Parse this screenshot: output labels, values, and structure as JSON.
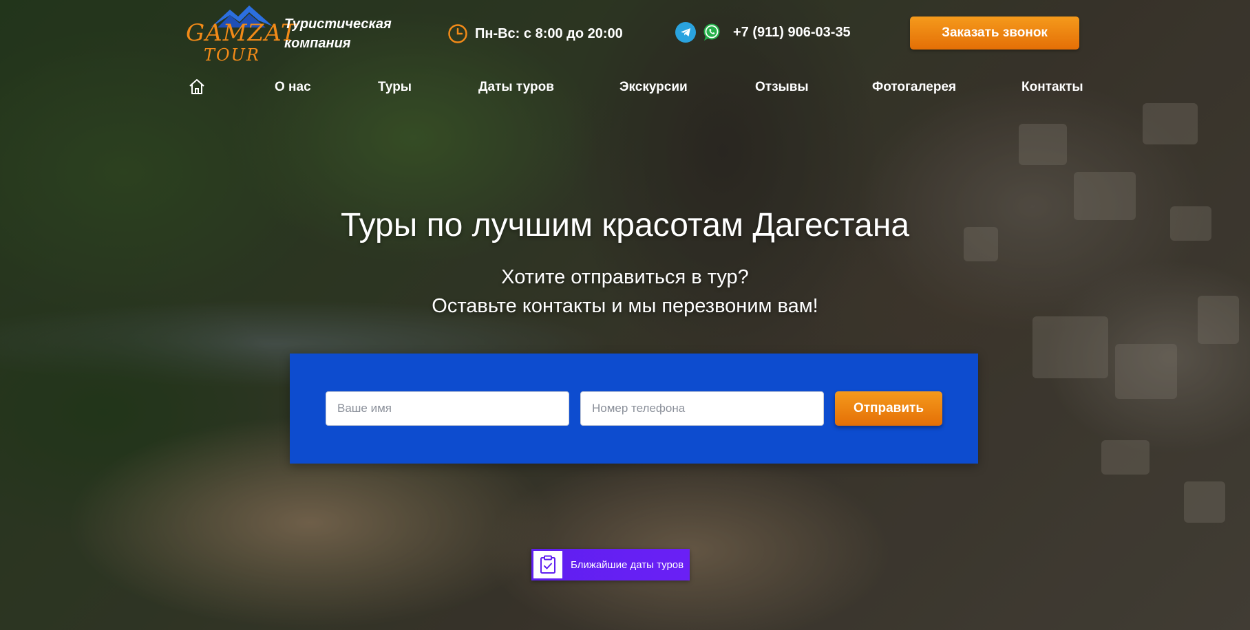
{
  "brand": {
    "logo_line1": "GAMZAT",
    "logo_line2": "TOUR",
    "tagline": "Туристическая компания"
  },
  "header": {
    "hours": "Пн-Вс: с 8:00 до 20:00",
    "phone": "+7 (911) 906-03-35",
    "call_button": "Заказать звонок"
  },
  "nav": {
    "items": [
      "О нас",
      "Туры",
      "Даты туров",
      "Экскурсии",
      "Отзывы",
      "Фотогалерея",
      "Контакты"
    ]
  },
  "hero": {
    "title": "Туры по лучшим красотам Дагестана",
    "subtitle_line1": "Хотите отправиться в тур?",
    "subtitle_line2": "Оставьте контакты и мы перезвоним вам!"
  },
  "form": {
    "name_placeholder": "Ваше имя",
    "phone_placeholder": "Номер телефона",
    "submit_label": "Отправить"
  },
  "upcoming": {
    "label": "Ближайшие даты туров"
  },
  "colors": {
    "accent_orange": "#f28a18",
    "form_blue": "#0d4ccf",
    "badge_purple": "#6a20f5",
    "telegram": "#2aa3df",
    "whatsapp": "#25b04a"
  },
  "icons": [
    "home-icon",
    "clock-icon",
    "telegram-icon",
    "whatsapp-icon",
    "clipboard-check-icon",
    "mountain-icon"
  ]
}
